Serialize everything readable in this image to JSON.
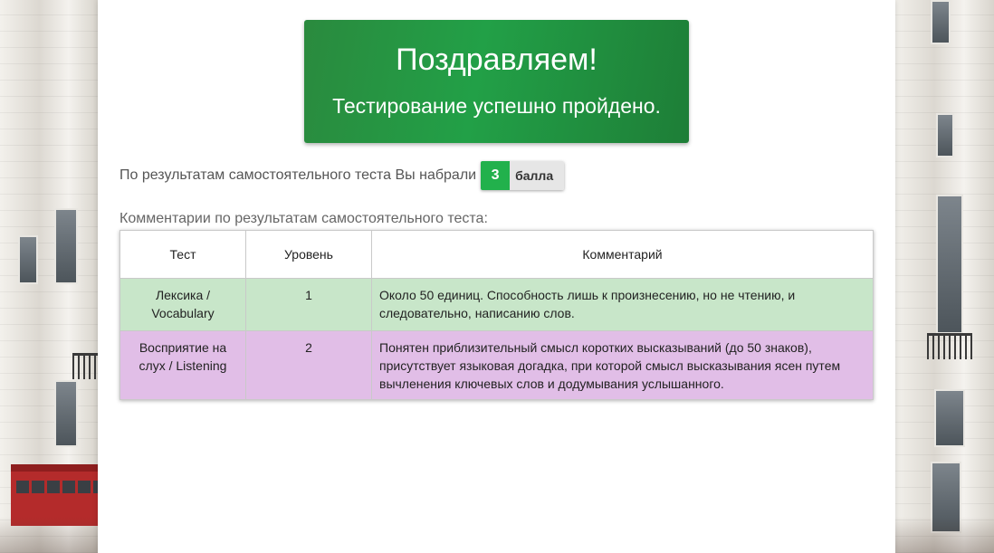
{
  "banner": {
    "title": "Поздравляем!",
    "subtitle": "Тестирование успешно пройдено."
  },
  "score": {
    "prefix": "По результатам самостоятельного теста Вы набрали",
    "value": "3",
    "unit": "балла"
  },
  "comments_caption": "Комментарии по результатам самостоятельного теста:",
  "table": {
    "headers": [
      "Тест",
      "Уровень",
      "Комментарий"
    ],
    "rows": [
      {
        "test": "Лексика / Vocabulary",
        "level": "1",
        "comment": "Около 50 единиц. Способность лишь к произнесению, но не чтению, и следовательно, написанию слов."
      },
      {
        "test": "Восприятие на слух / Listening",
        "level": "2",
        "comment": "Понятен приблизительный смысл коротких высказываний (до 50 знаков), присутствует языковая догадка, при которой смысл высказывания ясен путем вычленения ключевых слов и додумывания услышанного."
      }
    ]
  },
  "colors": {
    "banner_green": "#22a047",
    "score_green": "#22b14c",
    "row_vocabulary": "#c8e6c9",
    "row_listening": "#e1bee7"
  }
}
